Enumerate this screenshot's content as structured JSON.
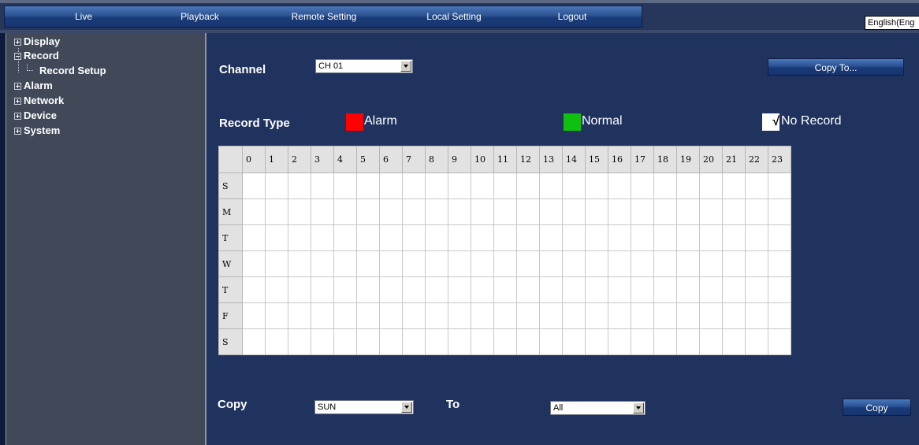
{
  "nav": {
    "items": [
      "Live",
      "Playback",
      "Remote Setting",
      "Local Setting",
      "Logout"
    ],
    "language": "English(Eng"
  },
  "sidebar": {
    "items": [
      {
        "label": "Display",
        "expanded": false
      },
      {
        "label": "Record",
        "expanded": true
      },
      {
        "label": "Record Setup",
        "child": true
      },
      {
        "label": "Alarm",
        "expanded": false
      },
      {
        "label": "Network",
        "expanded": false
      },
      {
        "label": "Device",
        "expanded": false
      },
      {
        "label": "System",
        "expanded": false
      }
    ]
  },
  "form": {
    "channel_label": "Channel",
    "channel_value": "CH 01",
    "copy_to_button": "Copy To...",
    "record_type_label": "Record Type",
    "legend": {
      "alarm": "Alarm",
      "normal": "Normal",
      "no_record": "No Record",
      "alarm_color": "#ff0000",
      "normal_color": "#10c010",
      "no_record_checked": true,
      "check_glyph": "√"
    },
    "copy_label": "Copy",
    "copy_from_value": "SUN",
    "to_label": "To",
    "copy_to_value": "All",
    "copy_button": "Copy"
  },
  "schedule": {
    "hours": [
      "0",
      "1",
      "2",
      "3",
      "4",
      "5",
      "6",
      "7",
      "8",
      "9",
      "10",
      "11",
      "12",
      "13",
      "14",
      "15",
      "16",
      "17",
      "18",
      "19",
      "20",
      "21",
      "22",
      "23"
    ],
    "days": [
      "S",
      "M",
      "T",
      "W",
      "T",
      "F",
      "S"
    ]
  }
}
